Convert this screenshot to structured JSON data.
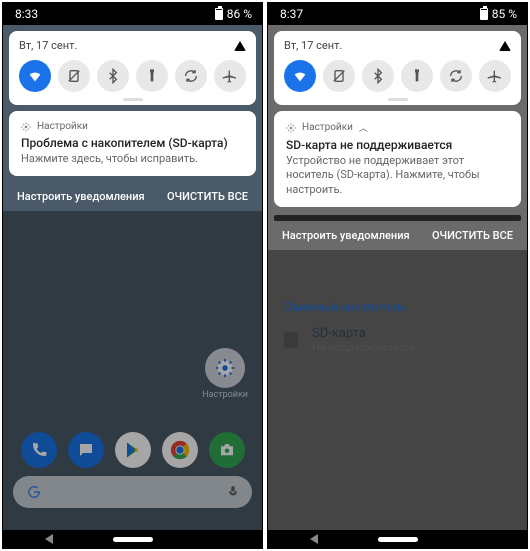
{
  "left": {
    "status": {
      "time": "8:33",
      "battery": "86 %"
    },
    "qs": {
      "date": "Вт, 17 сент."
    },
    "notif": {
      "app": "Настройки",
      "title": "Проблема с накопителем (SD-карта)",
      "body": "Нажмите здесь, чтобы исправить."
    },
    "actions": {
      "manage": "Настроить уведомления",
      "clear": "ОЧИСТИТЬ ВСЕ"
    },
    "home_label": "Настройки"
  },
  "right": {
    "status": {
      "time": "8:37",
      "battery": "85 %"
    },
    "qs": {
      "date": "Вт, 17 сент."
    },
    "notif": {
      "app": "Настройки",
      "title": "SD-карта не поддерживается",
      "body": "Устройство не поддерживает этот носитель (SD-карта). Нажмите, чтобы настроить."
    },
    "actions": {
      "manage": "Настроить уведомления",
      "clear": "ОЧИСТИТЬ ВСЕ"
    },
    "bg": {
      "section": "Съемный накопитель",
      "row_title": "SD-карта",
      "row_sub": "Не поддерживается"
    }
  }
}
